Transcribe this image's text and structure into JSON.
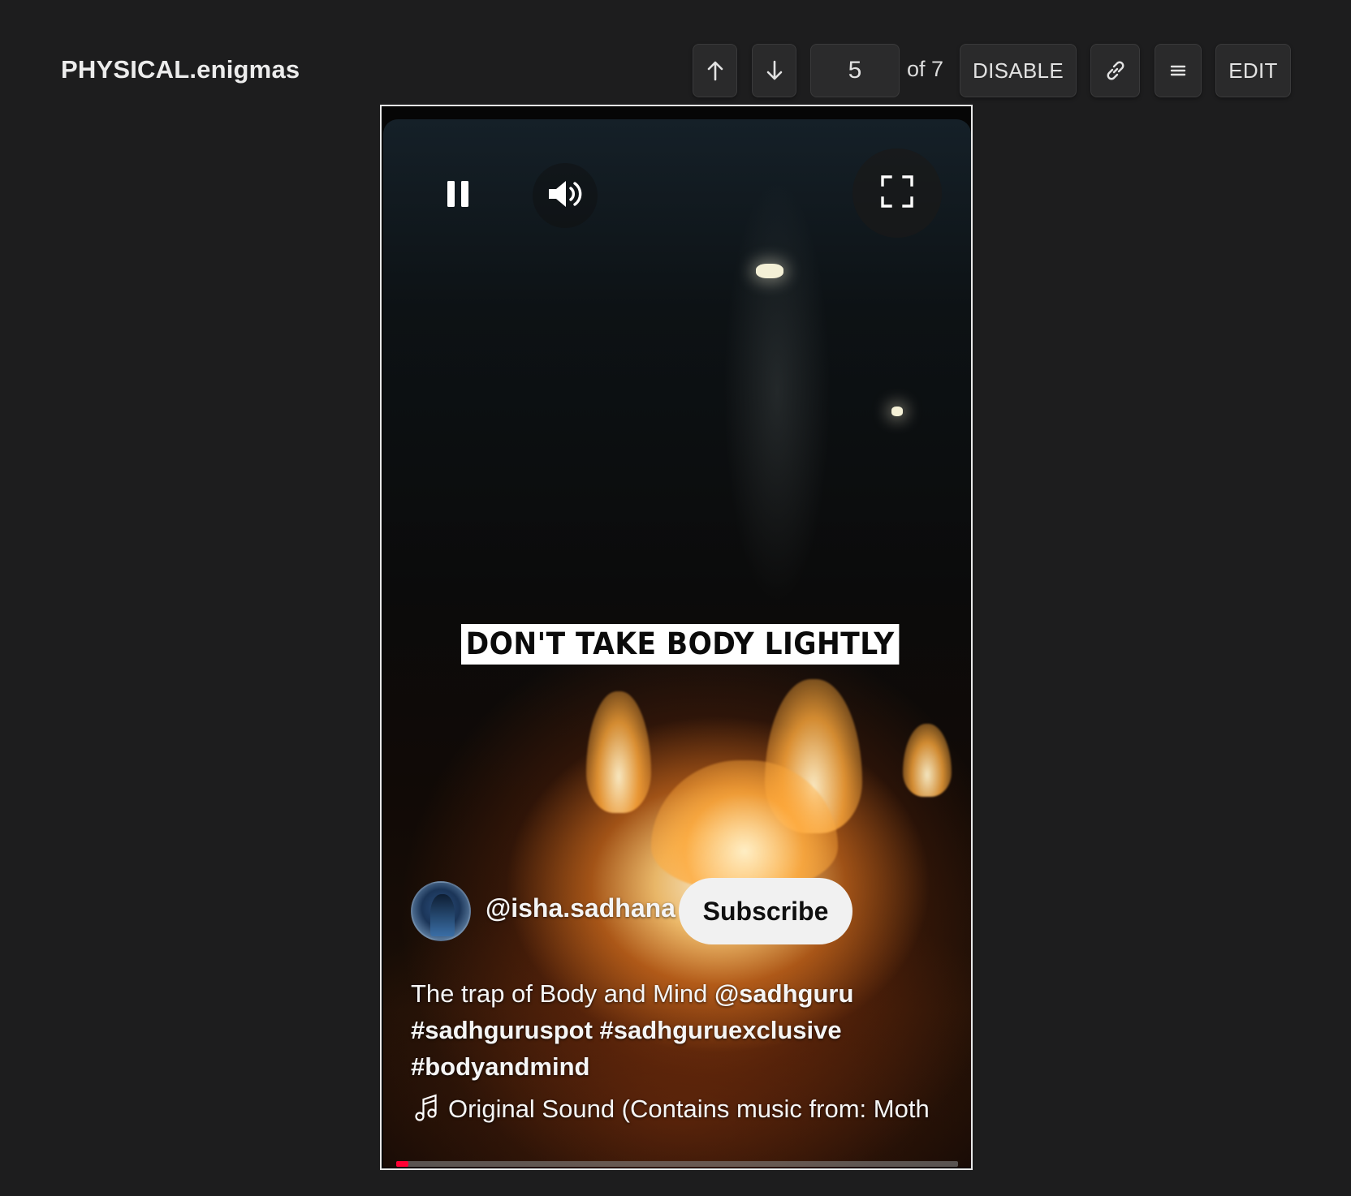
{
  "header": {
    "title": "PHYSICAL.enigmas",
    "up_icon": "arrow-up-icon",
    "down_icon": "arrow-down-icon",
    "current_index": "5",
    "of_total": "of 7",
    "disable_label": "DISABLE",
    "link_icon": "link-icon",
    "menu_icon": "menu-icon",
    "edit_label": "EDIT"
  },
  "video": {
    "overlay_caption": "DON'T TAKE BODY LIGHTLY",
    "controls": {
      "pause_icon": "pause-icon",
      "volume_icon": "volume-icon",
      "fullscreen_icon": "fullscreen-icon"
    },
    "channel": {
      "handle": "@isha.sadhana",
      "subscribe_label": "Subscribe"
    },
    "description": {
      "text": "The trap of Body and Mind ",
      "mention": "@sadhguru",
      "hashtags": "#sadhguruspot #sadhguruexclusive #bodyandmind"
    },
    "sound": {
      "icon": "music-note-icon",
      "text": "Original Sound (Contains music from: Moth"
    },
    "progress_fraction": 0.022,
    "colors": {
      "progress": "#ff0033",
      "subscribe_bg": "#f1f1f1"
    }
  }
}
